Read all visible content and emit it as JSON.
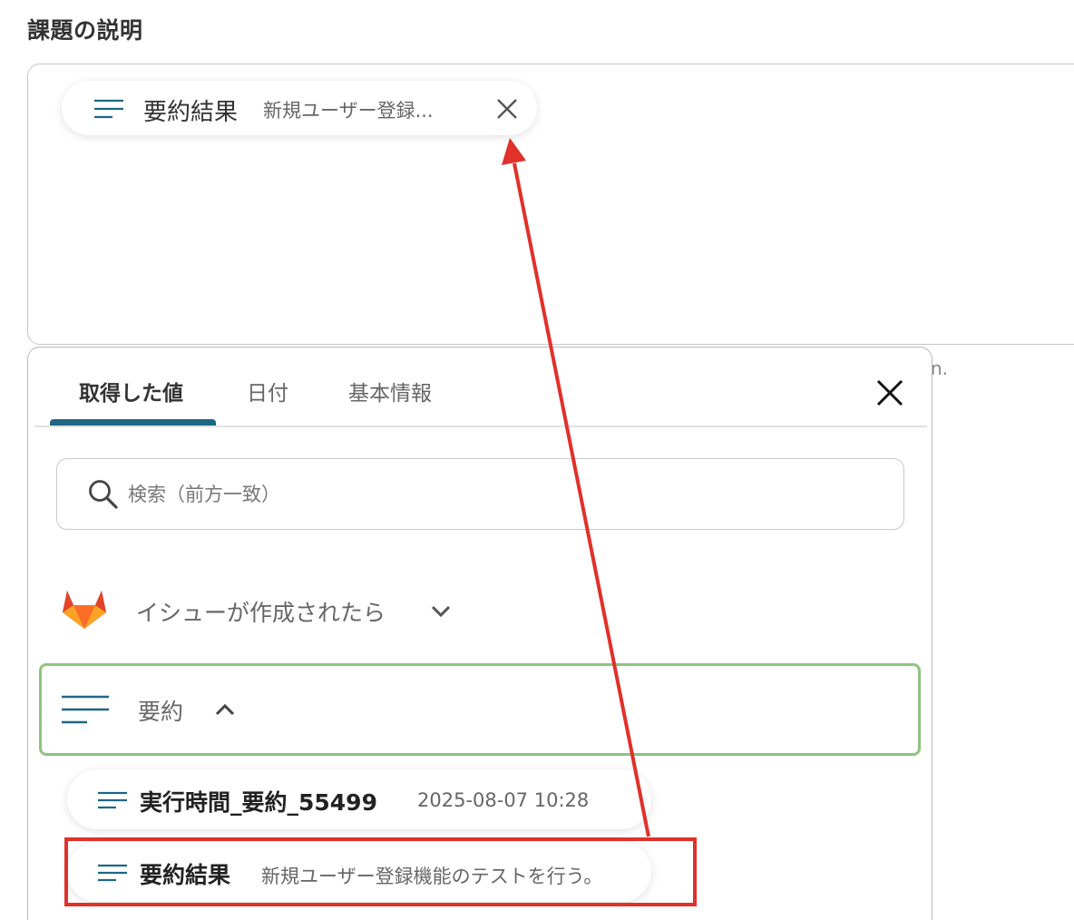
{
  "field": {
    "label": "課題の説明",
    "chip": {
      "label": "要約結果",
      "value": "新規ユーザー登録..."
    },
    "behind_text": "n."
  },
  "panel": {
    "tabs": [
      {
        "label": "取得した値",
        "active": true
      },
      {
        "label": "日付",
        "active": false
      },
      {
        "label": "基本情報",
        "active": false
      }
    ],
    "search_placeholder": "検索（前方一致）",
    "groups": [
      {
        "label": "イシューが作成されたら",
        "icon": "gitlab-icon",
        "expanded": false
      },
      {
        "label": "要約",
        "icon": "lines-icon",
        "expanded": true,
        "items": [
          {
            "label": "実行時間_要約_55499",
            "value": "2025-08-07 10:28"
          },
          {
            "label": "要約結果",
            "value": "新規ユーザー登録機能のテストを行う。"
          }
        ]
      }
    ]
  },
  "colors": {
    "accent": "#1f6783",
    "selected_border": "#8ec47f",
    "annotation_red": "#e0312a"
  }
}
